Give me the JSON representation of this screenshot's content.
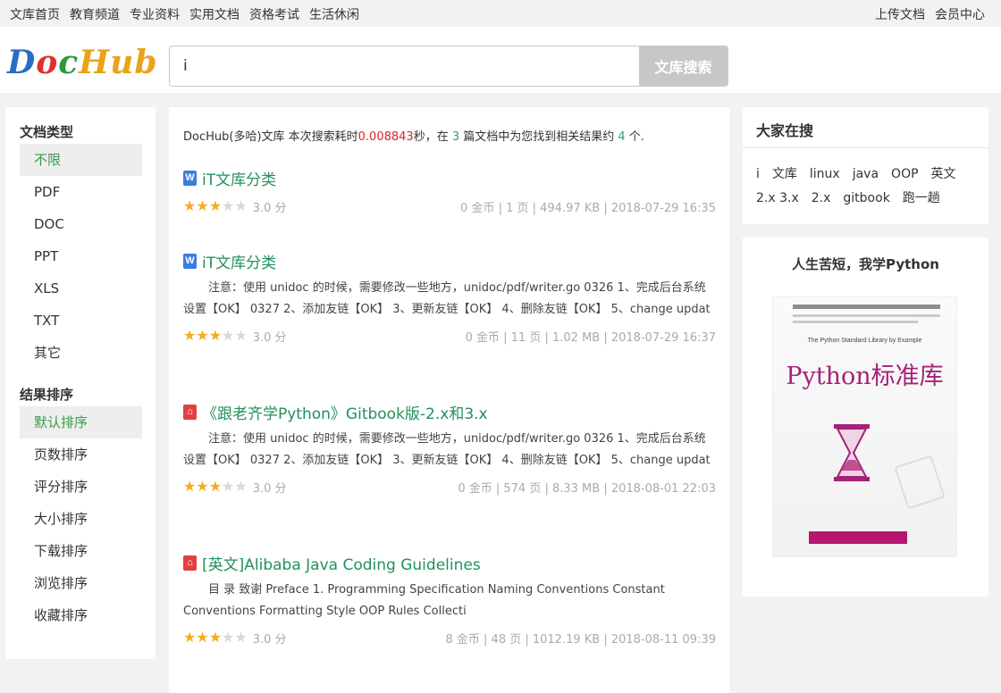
{
  "topnav": {
    "left": [
      "文库首页",
      "教育频道",
      "专业资料",
      "实用文档",
      "资格考试",
      "生活休闲"
    ],
    "right": [
      "上传文档",
      "会员中心"
    ]
  },
  "logo": {
    "p1": "D",
    "p2": "o",
    "p3": "c",
    "p4": "Hub"
  },
  "search": {
    "value": "i",
    "button": "文库搜索"
  },
  "sidebar": {
    "type_title": "文档类型",
    "types": [
      "不限",
      "PDF",
      "DOC",
      "PPT",
      "XLS",
      "TXT",
      "其它"
    ],
    "sort_title": "结果排序",
    "sorts": [
      "默认排序",
      "页数排序",
      "评分排序",
      "大小排序",
      "下载排序",
      "浏览排序",
      "收藏排序"
    ]
  },
  "summary": {
    "prefix": "DocHub(多哈)文库 本次搜索耗时",
    "time": "0.008843",
    "mid1": "秒，在 ",
    "docs": "3",
    "mid2": " 篇文档中为您找到相关结果约 ",
    "count": "4",
    "suffix": " 个."
  },
  "results": [
    {
      "icon": "word-file-icon",
      "icon_text": "W",
      "title": "iT文库分类",
      "desc": "",
      "score": "3.0 分",
      "meta": "0 金币 | 1 页 | 494.97 KB | 2018-07-29 16:35",
      "rating": 3
    },
    {
      "icon": "word-file-icon",
      "icon_text": "W",
      "title": "iT文库分类",
      "desc": "注意：使用 unidoc 的时候，需要修改一些地方，unidoc/pdf/writer.go 0326 1、完成后台系统设置【OK】 0327 2、添加友链【OK】 3、更新友链【OK】 4、删除友链【OK】 5、change updat",
      "score": "3.0 分",
      "meta": "0 金币 | 11 页 | 1.02 MB | 2018-07-29 16:37",
      "rating": 3
    },
    {
      "icon": "pdf-file-icon",
      "icon_text": "⌂",
      "title": "《跟老齐学Python》Gitbook版-2.x和3.x",
      "desc": "注意：使用 unidoc 的时候，需要修改一些地方，unidoc/pdf/writer.go 0326 1、完成后台系统设置【OK】 0327 2、添加友链【OK】 3、更新友链【OK】 4、删除友链【OK】 5、change updat",
      "score": "3.0 分",
      "meta": "0 金币 | 574 页 | 8.33 MB | 2018-08-01 22:03",
      "rating": 3
    },
    {
      "icon": "pdf-file-icon",
      "icon_text": "⌂",
      "title": "[英文]Alibaba Java Coding Guidelines",
      "desc": "目 录 致谢 Preface 1. Programming Specification Naming Conventions Constant Conventions Formatting Style OOP Rules Collecti",
      "score": "3.0 分",
      "meta": "8 金币 | 48 页 | 1012.19 KB | 2018-08-11 09:39",
      "rating": 3
    }
  ],
  "hot": {
    "title": "大家在搜",
    "tags": [
      "i",
      "文库",
      "linux",
      "java",
      "OOP",
      "英文",
      "2.x 3.x",
      "2.x",
      "gitbook",
      "跑一趟"
    ]
  },
  "ad": {
    "title": "人生苦短，我学Python",
    "book_sub": "The Python Standard Library by Example",
    "book_name": "Python标准库"
  },
  "colors": {
    "accent": "#21915a",
    "star": "#f6ac1b",
    "highlight_red": "#e0222a"
  }
}
